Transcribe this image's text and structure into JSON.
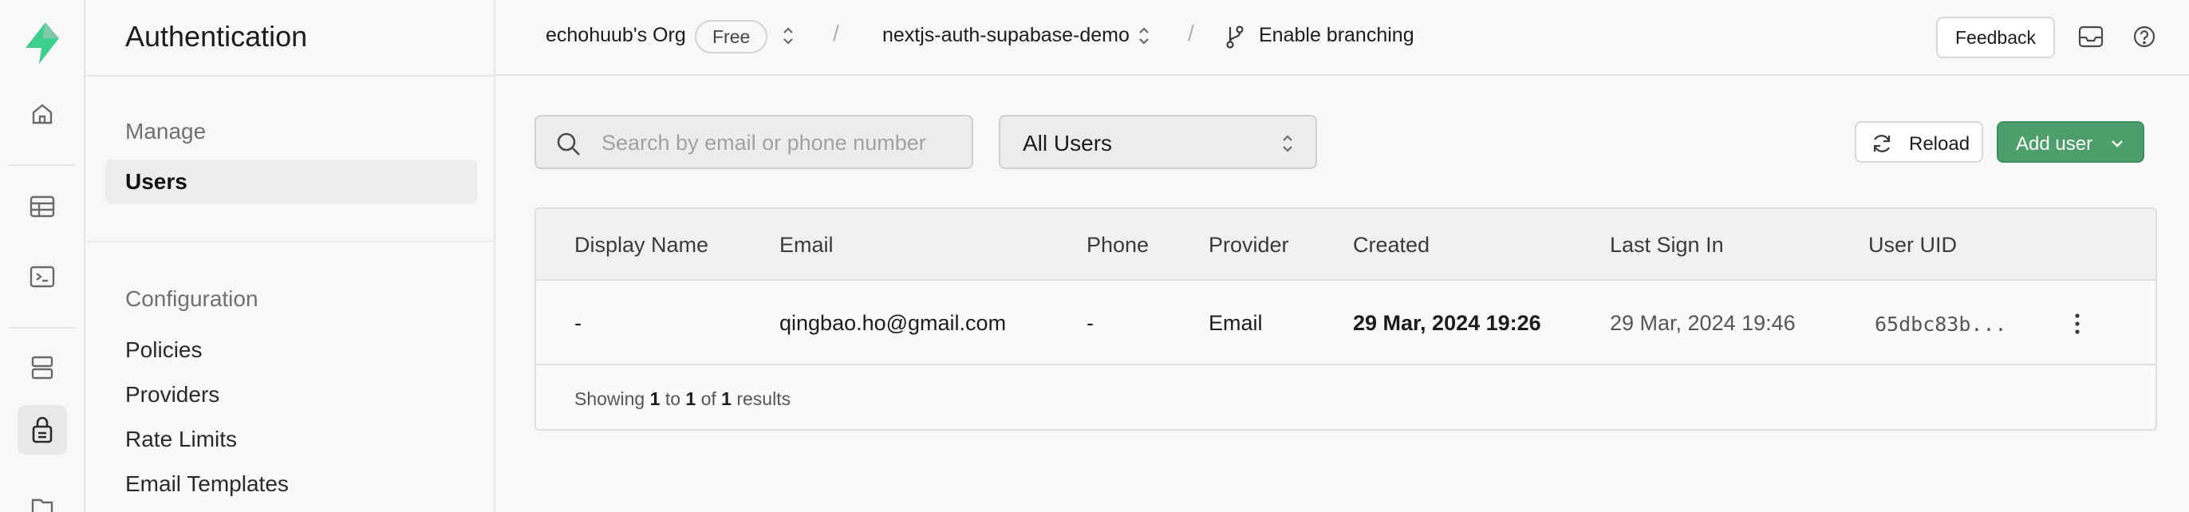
{
  "rail": {
    "icons": [
      "supabase-logo",
      "home-icon",
      "table-editor-icon",
      "sql-editor-icon",
      "database-icon",
      "authentication-icon",
      "storage-icon"
    ],
    "accent": "#3ecf8e"
  },
  "sidebar": {
    "title": "Authentication",
    "sections": [
      {
        "heading": "Manage",
        "items": [
          {
            "label": "Users",
            "active": true
          }
        ]
      },
      {
        "heading": "Configuration",
        "items": [
          {
            "label": "Policies"
          },
          {
            "label": "Providers"
          },
          {
            "label": "Rate Limits"
          },
          {
            "label": "Email Templates"
          }
        ]
      }
    ]
  },
  "topbar": {
    "org": "echohuub's Org",
    "plan_badge": "Free",
    "separator": "/",
    "project": "nextjs-auth-supabase-demo",
    "branching_label": "Enable branching",
    "feedback_label": "Feedback"
  },
  "toolbar": {
    "search_placeholder": "Search by email or phone number",
    "filter_value": "All Users",
    "reload_label": "Reload",
    "add_user_label": "Add user",
    "add_user_color": "#4d9e6b"
  },
  "table": {
    "columns": [
      "Display Name",
      "Email",
      "Phone",
      "Provider",
      "Created",
      "Last Sign In",
      "User UID"
    ],
    "rows": [
      {
        "display_name": "-",
        "email": "qingbao.ho@gmail.com",
        "phone": "-",
        "provider": "Email",
        "created": "29 Mar, 2024 19:26",
        "last_sign_in": "29 Mar, 2024 19:46",
        "user_uid": "65dbc83b..."
      }
    ],
    "footer": {
      "prefix": "Showing",
      "from": "1",
      "to_word": "to",
      "to": "1",
      "of_word": "of",
      "total": "1",
      "suffix": "results"
    }
  }
}
